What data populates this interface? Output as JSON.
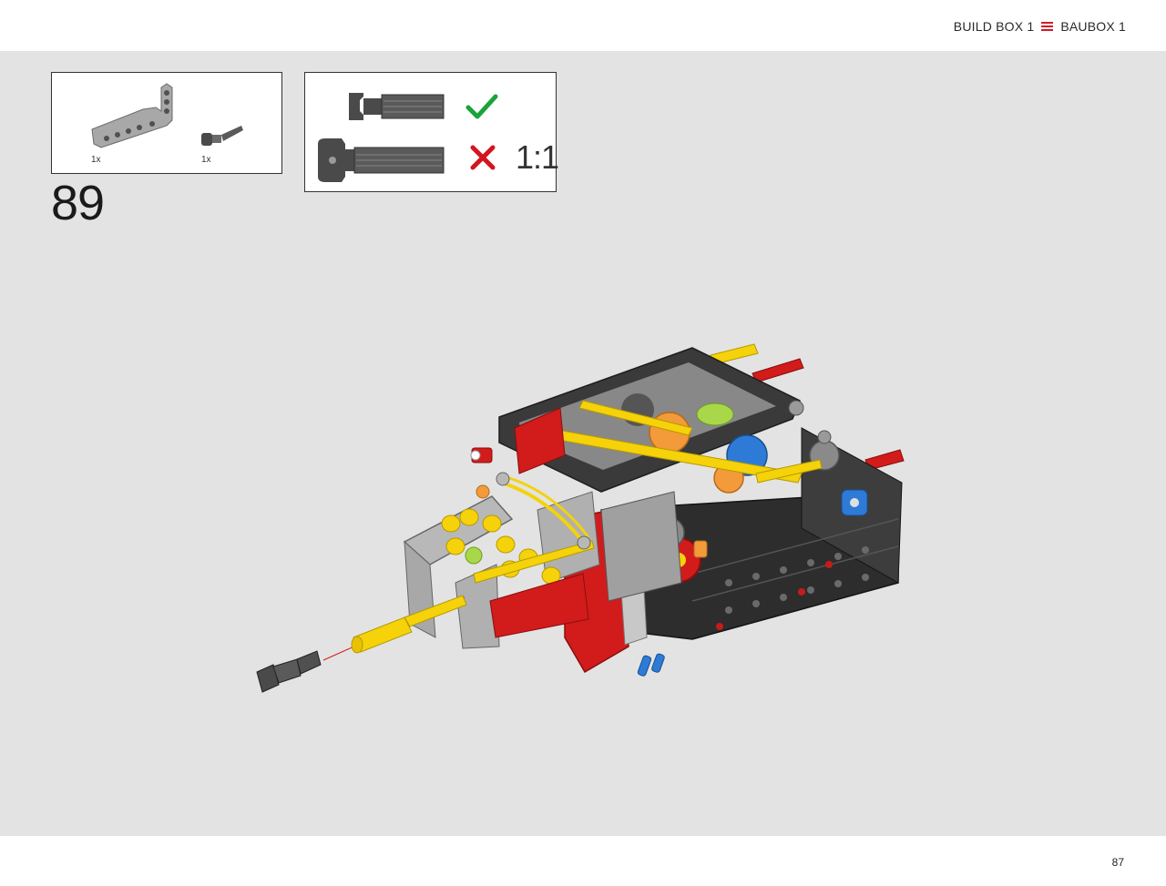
{
  "header": {
    "build_box_en": "BUILD BOX 1",
    "build_box_de": "BAUBOX 1",
    "accent_color": "#d01a2a",
    "menu_icon": "menu-icon"
  },
  "parts_list": {
    "items": [
      {
        "icon": "l-beam-part-icon",
        "quantity": "1x",
        "color": "#a0a0a0"
      },
      {
        "icon": "axle-pin-part-icon",
        "quantity": "1x",
        "color": "#555555"
      }
    ]
  },
  "callout": {
    "correct_icon": "checkmark-icon",
    "correct_color": "#1aa33a",
    "wrong_icon": "cross-icon",
    "wrong_color": "#d4141e",
    "scale": "1:1"
  },
  "step": {
    "number": "89"
  },
  "footer": {
    "page_number": "87"
  },
  "colors": {
    "background": "#e3e3e3",
    "frame_dark": "#3a3a3a",
    "frame_gray": "#9a9a9a",
    "red": "#d21b1b",
    "yellow": "#f5d20a",
    "blue": "#2d7bd6",
    "orange": "#f39a3a",
    "lime": "#a8d84a"
  }
}
